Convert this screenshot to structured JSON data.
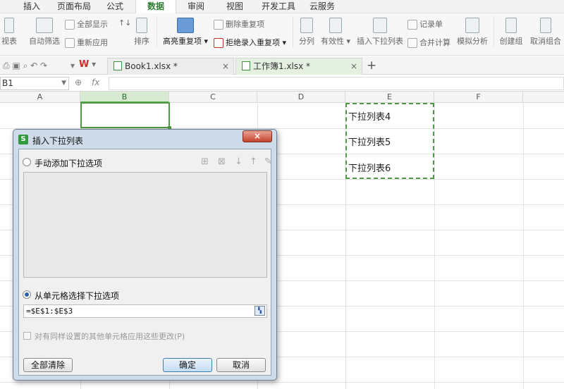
{
  "menu": {
    "tabs": [
      "插入",
      "页面布局",
      "公式",
      "数据",
      "审阅",
      "视图",
      "开发工具",
      "云服务"
    ],
    "active": "数据"
  },
  "ribbon": {
    "pivot_partial": "视表",
    "auto_filter": "自动筛选",
    "show_all": "全部显示",
    "reapply": "重新应用",
    "sort": "排序",
    "highlight_dup": "高亮重复项",
    "delete_dup": "删除重复项",
    "reject_dup": "拒绝录入重复项",
    "split_col": "分列",
    "validity": "有效性",
    "insert_dropdown": "插入下拉列表",
    "record_sheet": "记录单",
    "consolidate": "合并计算",
    "what_if": "模拟分析",
    "create_group": "创建组",
    "ungroup": "取消组合"
  },
  "doc_tabs": [
    {
      "name": "Book1.xlsx *",
      "close": "×"
    },
    {
      "name": "工作簿1.xlsx *",
      "close": "×"
    }
  ],
  "new_tab": "+",
  "wps_logo": "W",
  "formula_bar": {
    "cell_ref": "B1",
    "fx": "fx"
  },
  "columns": [
    "A",
    "B",
    "C",
    "D",
    "E",
    "F"
  ],
  "cells": {
    "E1": "下拉列表4",
    "E2": "下拉列表5",
    "E3": "下拉列表6"
  },
  "dialog": {
    "title": "插入下拉列表",
    "close": "×",
    "option_manual": "手动添加下拉选项",
    "option_from_cells": "从单元格选择下拉选项",
    "reference_value": "=$E$1:$E$3",
    "apply_same_label": "对有同样设置的其他单元格应用这些更改(P)",
    "clear_all": "全部清除",
    "ok": "确定",
    "cancel": "取消"
  }
}
